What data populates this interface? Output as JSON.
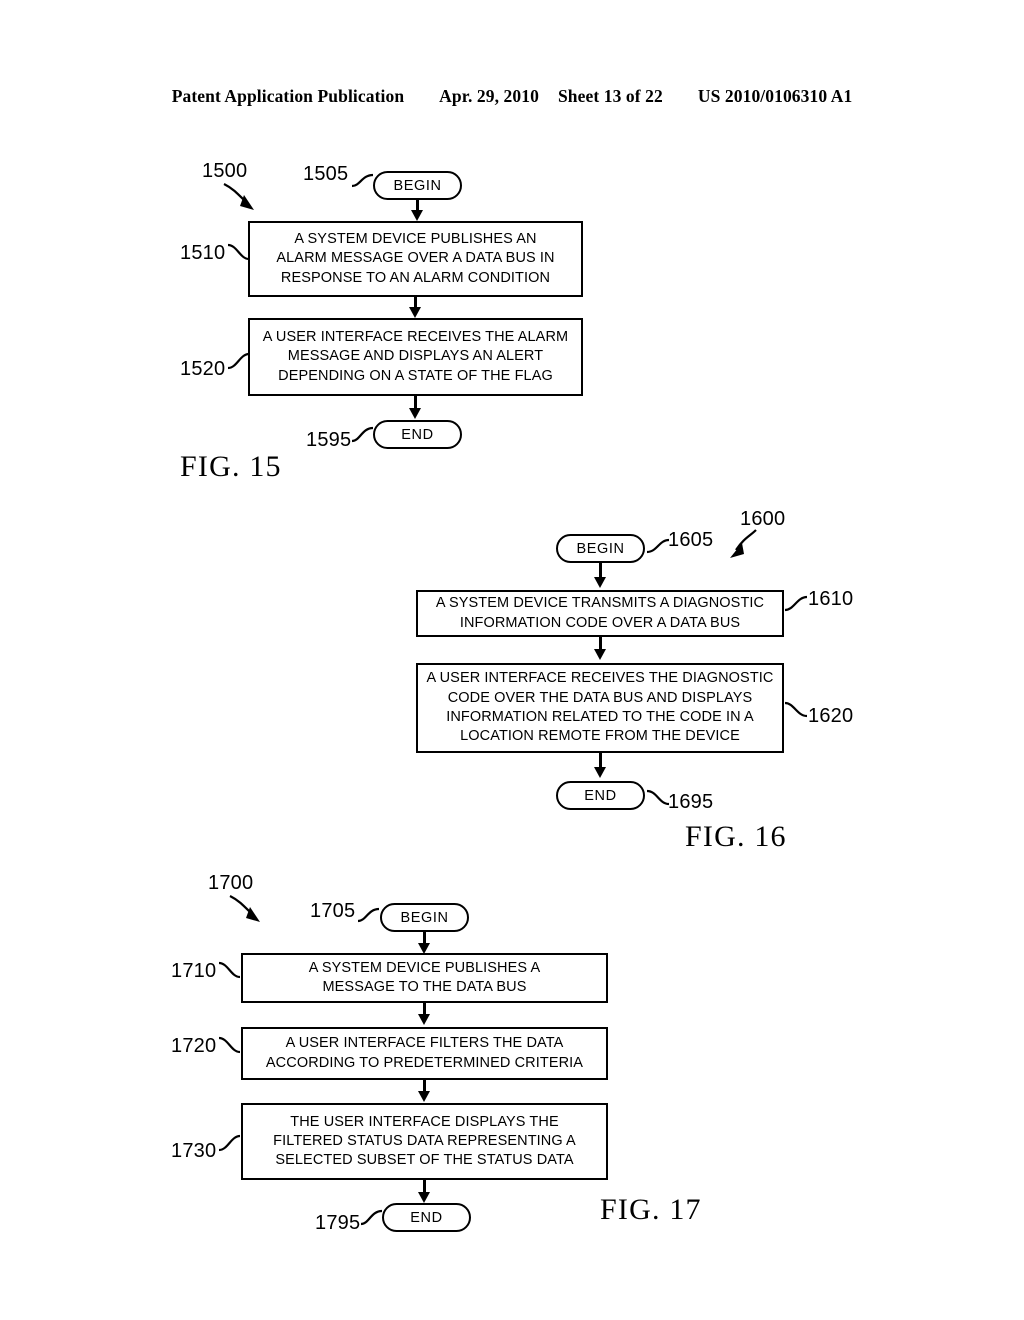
{
  "header": {
    "publication": "Patent Application Publication",
    "date": "Apr. 29, 2010",
    "sheet": "Sheet 13 of 22",
    "patent_number": "US 2010/0106310 A1"
  },
  "figures": [
    {
      "caption": "FIG. 15",
      "flow_ref": "1500",
      "nodes": [
        {
          "ref": "1505",
          "type": "terminator",
          "label": "BEGIN"
        },
        {
          "ref": "1510",
          "type": "process",
          "label": "A SYSTEM DEVICE PUBLISHES AN\nALARM MESSAGE OVER A DATA BUS IN\nRESPONSE TO AN ALARM CONDITION"
        },
        {
          "ref": "1520",
          "type": "process",
          "label": "A USER INTERFACE RECEIVES THE ALARM\nMESSAGE AND DISPLAYS AN ALERT\nDEPENDING ON A STATE OF THE FLAG"
        },
        {
          "ref": "1595",
          "type": "terminator",
          "label": "END"
        }
      ]
    },
    {
      "caption": "FIG. 16",
      "flow_ref": "1600",
      "nodes": [
        {
          "ref": "1605",
          "type": "terminator",
          "label": "BEGIN"
        },
        {
          "ref": "1610",
          "type": "process",
          "label": "A SYSTEM DEVICE TRANSMITS A DIAGNOSTIC\nINFORMATION CODE OVER A DATA BUS"
        },
        {
          "ref": "1620",
          "type": "process",
          "label": "A USER INTERFACE RECEIVES THE DIAGNOSTIC\nCODE OVER THE DATA BUS AND DISPLAYS\nINFORMATION RELATED TO THE CODE IN A\nLOCATION REMOTE FROM THE DEVICE"
        },
        {
          "ref": "1695",
          "type": "terminator",
          "label": "END"
        }
      ]
    },
    {
      "caption": "FIG. 17",
      "flow_ref": "1700",
      "nodes": [
        {
          "ref": "1705",
          "type": "terminator",
          "label": "BEGIN"
        },
        {
          "ref": "1710",
          "type": "process",
          "label": "A SYSTEM DEVICE PUBLISHES A\nMESSAGE TO THE DATA BUS"
        },
        {
          "ref": "1720",
          "type": "process",
          "label": "A USER INTERFACE FILTERS THE DATA\nACCORDING TO PREDETERMINED CRITERIA"
        },
        {
          "ref": "1730",
          "type": "process",
          "label": "THE USER INTERFACE DISPLAYS THE\nFILTERED STATUS DATA REPRESENTING A\nSELECTED SUBSET OF THE STATUS DATA"
        },
        {
          "ref": "1795",
          "type": "terminator",
          "label": "END"
        }
      ]
    }
  ]
}
